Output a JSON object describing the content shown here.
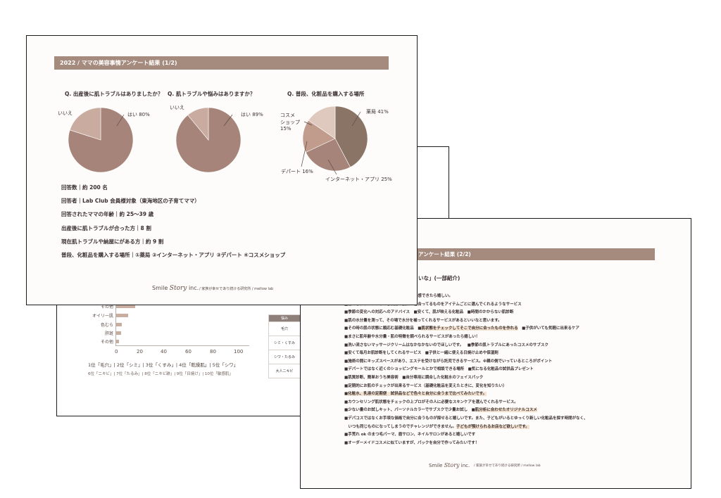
{
  "back_slide": {
    "bar_labels": [
      "その他",
      "オイリー肌",
      "色むら",
      "肝斑",
      "その他"
    ],
    "axis_ticks": [
      "0",
      "20",
      "40",
      "60",
      "80",
      "100"
    ],
    "ranking": {
      "line1": "1位「毛穴」| 2位「シミ」| 3位「くすみ」| 4位「乾燥肌」| 5位「シワ」",
      "line2": "6位「ニキビ」| 7位「たるみ」| 8位「ニキビ跡」| 9位「日焼け」| 10位「敏感肌」"
    },
    "table": {
      "header": "悩み",
      "rows": [
        "毛穴",
        "シミ・くすみ",
        "シワ・たるみ",
        "大人ニキビ"
      ]
    }
  },
  "front_slide": {
    "title": "2022 / ママの美容事情アンケート結果 (1/2)",
    "questions": [
      "Q. 出産後に肌トラブルはありましたか？",
      "Q. 肌トラブルや悩みはありますか？",
      "Q. 普段、化粧品を購入する場所"
    ],
    "chart_data": [
      {
        "type": "pie",
        "title": "Q. 出産後に肌トラブルはありましたか？",
        "series": [
          {
            "label": "はい 80%",
            "value": 80
          },
          {
            "label": "いいえ",
            "value": 20
          }
        ]
      },
      {
        "type": "pie",
        "title": "Q. 肌トラブルや悩みはありますか？",
        "series": [
          {
            "label": "はい 89%",
            "value": 89
          },
          {
            "label": "いいえ",
            "value": 11
          }
        ]
      },
      {
        "type": "pie",
        "title": "Q. 普段、化粧品を購入する場所",
        "series": [
          {
            "label": "薬局 41%",
            "value": 41
          },
          {
            "label": "インターネット・アプリ 25%",
            "value": 25
          },
          {
            "label": "デパート 16%",
            "value": 16
          },
          {
            "label": "コスメショップ 15%",
            "value": 15
          }
        ]
      }
    ],
    "labels": {
      "p1_yes": "はい 80%",
      "p1_no": "いいえ",
      "p2_yes": "はい 89%",
      "p2_no": "いいえ",
      "p3_pharmacy": "薬局 41%",
      "p3_internet": "インターネット・アプリ 25%",
      "p3_department": "デパート 16%",
      "p3_cosme_1": "コスメ",
      "p3_cosme_2": "ショップ",
      "p3_cosme_3": "15%"
    },
    "colors": {
      "dark": "#8a7466",
      "main": "#a68479",
      "mid": "#c19c8d",
      "light": "#c9ab9f",
      "pale": "#dfc9bf",
      "title_bar": "#a58a7e"
    },
    "stats": [
      "回答数｜約 200 名",
      "回答者｜Lab Club 会員様対象（東海地区の子育てママ）",
      "回答されたママの年齢｜約 25〜39 歳",
      "出産後に肌トラブルが合った方｜8 割",
      "現在肌トラブルや納屋にがある方｜約 9 割",
      "普段、化粧品を購入する場所｜①薬局 ②インターネット・アプリ ③デパート ④コスメショップ"
    ],
    "footer": {
      "logo_pre": "Smile",
      "logo_story": "Story",
      "logo_post": "inc.",
      "tagline": "/ 家族が幸せであり続ける研究所 / mellow lab"
    }
  },
  "right_slide": {
    "title": "アンケート結果 (2/2)",
    "subtitle": "いな」(一部紹介)",
    "lines": [
      "成分が本当に肌にいいのか勉強会などで体感できたら嬉しい。",
      "■様々なブランドの中から自分の肌に一番合ってるものをアイテムごとに選んでくれるようなサービス",
      "■季節の変化への対応へのアドバイス　■安くて、肌が映える化粧品　■時間のかからない肌診断",
      "■肌の水分量を測って、その場で水分を補ってくれるサービスがあるといいなと思います。",
      "■その時の肌の状態に順応む基礎化粧品　■肌状態をチェックしてそこで自分に合ったものを作れる　■子供がいても気軽に出来るケア",
      "■まさに肌年齢や水分量・肌の特徴を調べられるサービスがあったら嬉しい！",
      "■洗い流さないマッサージクリームはなかなかないのでほしいです。　■季節の肌トラブルにあったコスメのサブスク",
      "■安くて毎月お肌診断をしてくれるサービス　■子供と一緒に使える日焼け止めや保湿剤",
      "■施術の間にキッズスペースがあり、エステを受けながら託児できるサービス。※親の側でいっているところがポイント",
      "■デパートではなく近くのショッピングモールとかで相談できる場所　■気になる化粧品の試供品プレゼント",
      "■肌質診断、簡単おうち美容術　■自分専用に調合した化粧水のフェイスパック",
      "■定期的にお肌のチェックが出来るサービス（基礎化粧品を変えたときに、変化を知りたい）",
      "■化粧水、乳液の定期便　試供品などで色々と自分に合うまで比べてみたいです。",
      "■カウンセリング肌状態をチェックの上プロがその人に必要なスキンケアを選んでくれるサービス。",
      "■少ない量のお試しキット、パーソナルカラーでサブスクで少量お試し　■肌分析に合わせたオリジナルコスメ",
      "■デパコスではなくお手頃な価格で自分に合うものが探せると嬉しいです。また、子どもがいるとゆっくり新しい化粧品を探す時間がなく、",
      "　いつも同じものになってしまうのでチャレンジができません。子どもが預けられるお店など欲しいです。",
      "■手荒れ ok のまつ毛パーマ、眉サロン、ネイルサロンがあると嬉しいです",
      "■オーダーメイドコスメに似ていますが、パックを自分で作ってみたいです！"
    ],
    "footer": {
      "logo_pre": "Smile",
      "logo_story": "Story",
      "logo_post": "inc.",
      "tagline": "/ 家族が幸せであり続ける研究所 / mellow lab"
    }
  }
}
